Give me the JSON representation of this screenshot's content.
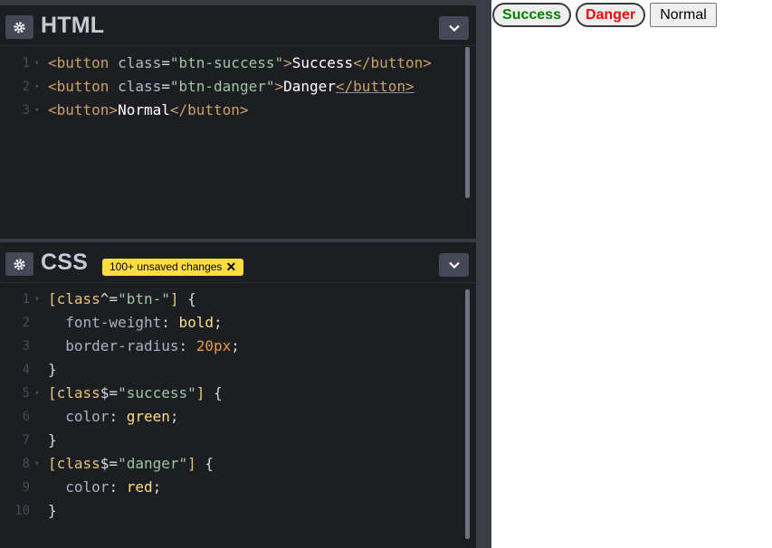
{
  "html_panel": {
    "title": "HTML",
    "lines": [
      {
        "n": "1",
        "fold": "▾",
        "parts": [
          [
            "tag",
            "<button "
          ],
          [
            "attr",
            "class"
          ],
          [
            "punc",
            "="
          ],
          [
            "str",
            "\"btn-success\""
          ],
          [
            "tag",
            ">"
          ],
          [
            "plain",
            "Success"
          ],
          [
            "tag",
            "</button>"
          ]
        ]
      },
      {
        "n": "2",
        "fold": "▾",
        "parts": [
          [
            "tag",
            "<button "
          ],
          [
            "attr",
            "class"
          ],
          [
            "punc",
            "="
          ],
          [
            "str",
            "\"btn-danger\""
          ],
          [
            "tag",
            ">"
          ],
          [
            "plain",
            "Danger"
          ],
          [
            "tag under",
            "</button>"
          ]
        ]
      },
      {
        "n": "3",
        "fold": "▾",
        "parts": [
          [
            "tag",
            "<button>"
          ],
          [
            "plain",
            "Normal"
          ],
          [
            "tag",
            "</button>"
          ]
        ]
      }
    ]
  },
  "css_panel": {
    "title": "CSS",
    "badge": "100+ unsaved changes",
    "badge_close": "✕",
    "lines": [
      {
        "n": "1",
        "fold": "▾",
        "parts": [
          [
            "sel",
            "[class"
          ],
          [
            "punc",
            "^="
          ],
          [
            "str",
            "\"btn-\""
          ],
          [
            "sel",
            "]"
          ],
          [
            "punc",
            " {"
          ]
        ]
      },
      {
        "n": "2",
        "fold": "",
        "parts": [
          [
            "punc",
            "  "
          ],
          [
            "prop",
            "font-weight"
          ],
          [
            "punc",
            ": "
          ],
          [
            "val",
            "bold"
          ],
          [
            "punc",
            ";"
          ]
        ]
      },
      {
        "n": "3",
        "fold": "",
        "parts": [
          [
            "punc",
            "  "
          ],
          [
            "prop",
            "border-radius"
          ],
          [
            "punc",
            ": "
          ],
          [
            "num",
            "20px"
          ],
          [
            "punc",
            ";"
          ]
        ]
      },
      {
        "n": "4",
        "fold": "",
        "parts": [
          [
            "punc",
            "}"
          ]
        ]
      },
      {
        "n": "5",
        "fold": "▾",
        "parts": [
          [
            "sel",
            "[class"
          ],
          [
            "punc",
            "$="
          ],
          [
            "str",
            "\"success\""
          ],
          [
            "sel",
            "]"
          ],
          [
            "punc",
            " {"
          ]
        ]
      },
      {
        "n": "6",
        "fold": "",
        "parts": [
          [
            "punc",
            "  "
          ],
          [
            "prop",
            "color"
          ],
          [
            "punc",
            ": "
          ],
          [
            "val",
            "green"
          ],
          [
            "punc",
            ";"
          ]
        ]
      },
      {
        "n": "7",
        "fold": "",
        "parts": [
          [
            "punc",
            "}"
          ]
        ]
      },
      {
        "n": "8",
        "fold": "▾",
        "parts": [
          [
            "sel",
            "[class"
          ],
          [
            "punc",
            "$="
          ],
          [
            "str",
            "\"danger\""
          ],
          [
            "sel",
            "]"
          ],
          [
            "punc",
            " {"
          ]
        ]
      },
      {
        "n": "9",
        "fold": "",
        "parts": [
          [
            "punc",
            "  "
          ],
          [
            "prop",
            "color"
          ],
          [
            "punc",
            ": "
          ],
          [
            "val",
            "red"
          ],
          [
            "punc",
            ";"
          ]
        ]
      },
      {
        "n": "10",
        "fold": "",
        "parts": [
          [
            "punc",
            "}"
          ]
        ]
      }
    ]
  },
  "preview": {
    "success_label": "Success",
    "danger_label": "Danger",
    "normal_label": "Normal"
  },
  "colors": {
    "editor_bg": "#1d1e22",
    "button_bg": "#444857",
    "badge_bg": "#ffdd40",
    "success": "#008000",
    "danger": "#ff0000"
  }
}
